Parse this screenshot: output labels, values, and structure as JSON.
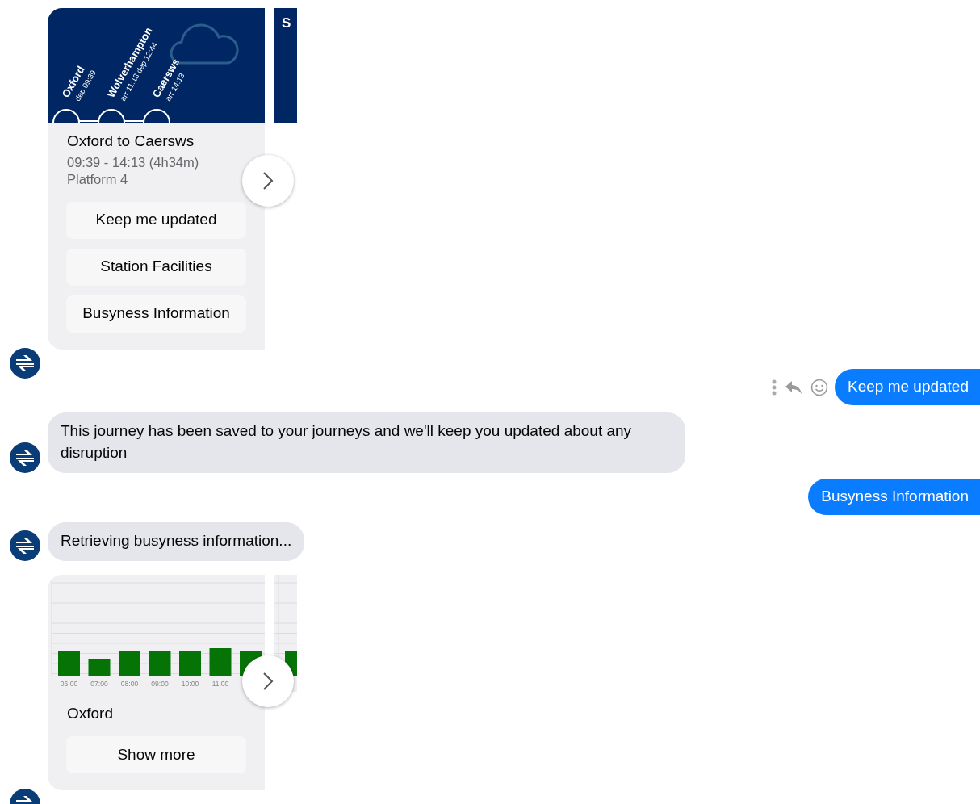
{
  "messages": [
    {
      "kind": "carousel",
      "cards": [
        {
          "kind": "journey",
          "stations": [
            {
              "name": "Oxford",
              "detail": "dep 09:39"
            },
            {
              "name": "Wolverhampton",
              "detail": "arr 11:13 dep 12:44"
            },
            {
              "name": "Caersws",
              "detail": "arr 14:13"
            }
          ],
          "title": "Oxford to Caersws",
          "lines": [
            "09:39 - 14:13 (4h34m)",
            "Platform 4"
          ],
          "buttons": [
            "Keep me updated",
            "Station Facilities",
            "Busyness Information"
          ]
        },
        {
          "kind": "journey_partial",
          "header": "S"
        }
      ]
    },
    {
      "kind": "user",
      "text": "Keep me updated",
      "actions": true
    },
    {
      "kind": "bot",
      "text": "This journey has been saved to your journeys and we'll keep you updated about any disruption"
    },
    {
      "kind": "user",
      "text": "Busyness Information",
      "actions": false
    },
    {
      "kind": "bot",
      "text": "Retrieving busyness information..."
    },
    {
      "kind": "carousel",
      "cards": [
        {
          "kind": "busyness",
          "hours": [
            "06:00",
            "07:00",
            "08:00",
            "09:00",
            "10:00",
            "11:00"
          ],
          "title": "Oxford",
          "buttons": [
            "Show more"
          ]
        },
        {
          "kind": "busyness_partial"
        }
      ]
    }
  ]
}
